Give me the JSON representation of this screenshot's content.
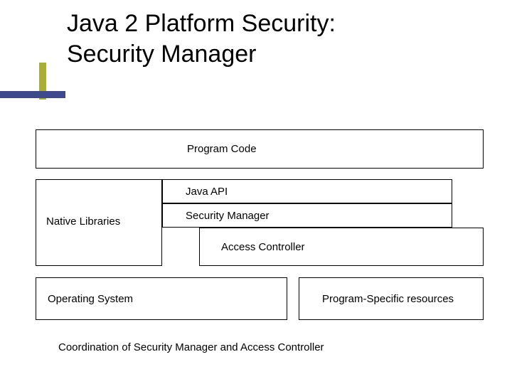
{
  "title": "Java 2 Platform Security:\nSecurity Manager",
  "boxes": {
    "program_code": "Program Code",
    "java_api": "Java API",
    "native_libraries": "Native Libraries",
    "security_manager": "Security Manager",
    "access_controller": "Access Controller",
    "operating_system": "Operating System",
    "program_specific_resources": "Program-Specific resources"
  },
  "caption": "Coordination of Security Manager and Access Controller"
}
